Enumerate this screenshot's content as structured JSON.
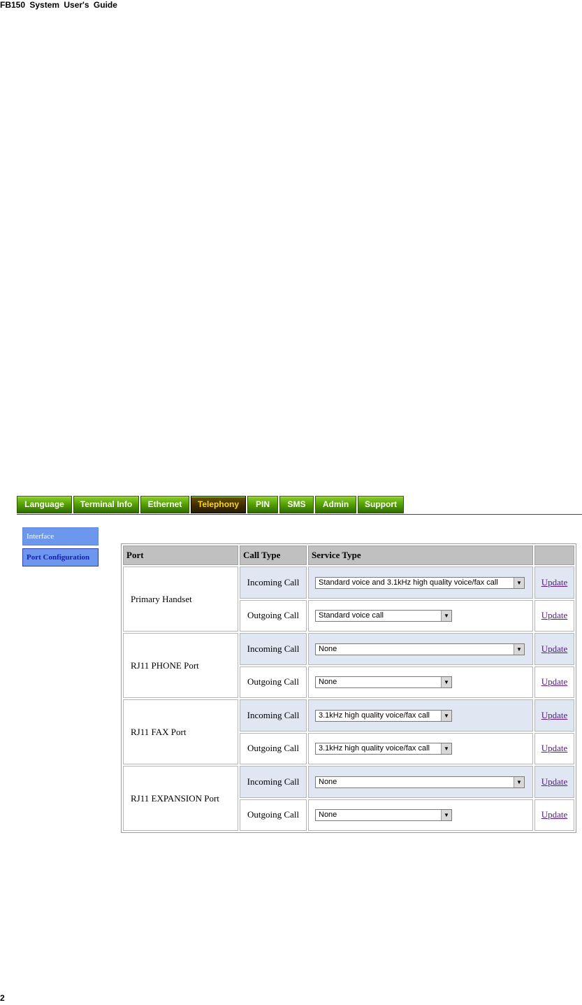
{
  "doc_header": "FB150 System User's Guide",
  "page_number": "2",
  "tabs": [
    {
      "label": "Language",
      "active": false
    },
    {
      "label": "Terminal Info",
      "active": false
    },
    {
      "label": "Ethernet",
      "active": false
    },
    {
      "label": "Telephony",
      "active": true
    },
    {
      "label": "PIN",
      "active": false
    },
    {
      "label": "SMS",
      "active": false
    },
    {
      "label": "Admin",
      "active": false
    },
    {
      "label": "Support",
      "active": false
    }
  ],
  "side_menu": [
    {
      "label": "Interface",
      "selected": false
    },
    {
      "label": "Port Configuration",
      "selected": true
    }
  ],
  "table": {
    "headers": {
      "port": "Port",
      "call_type": "Call Type",
      "service_type": "Service Type",
      "action": ""
    },
    "ports": [
      {
        "name": "Primary Handset",
        "incoming": {
          "call_type": "Incoming Call",
          "service": "Standard voice and 3.1kHz high quality voice/fax call",
          "action": "Update"
        },
        "outgoing": {
          "call_type": "Outgoing Call",
          "service": "Standard voice call",
          "action": "Update"
        }
      },
      {
        "name": "RJ11 PHONE Port",
        "incoming": {
          "call_type": "Incoming Call",
          "service": "None",
          "action": "Update"
        },
        "outgoing": {
          "call_type": "Outgoing Call",
          "service": "None",
          "action": "Update"
        }
      },
      {
        "name": "RJ11 FAX Port",
        "incoming": {
          "call_type": "Incoming Call",
          "service": "3.1kHz high quality voice/fax call",
          "action": "Update"
        },
        "outgoing": {
          "call_type": "Outgoing Call",
          "service": "3.1kHz high quality voice/fax call",
          "action": "Update"
        }
      },
      {
        "name": "RJ11 EXPANSION Port",
        "incoming": {
          "call_type": "Incoming Call",
          "service": "None",
          "action": "Update"
        },
        "outgoing": {
          "call_type": "Outgoing Call",
          "service": "None",
          "action": "Update"
        }
      }
    ]
  }
}
